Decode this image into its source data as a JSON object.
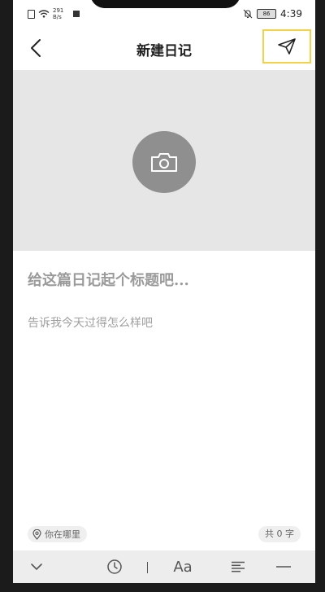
{
  "status_bar": {
    "net_speed_top": "291",
    "net_speed_bottom": "B/s",
    "battery": "86",
    "time": "4:39"
  },
  "header": {
    "title": "新建日记"
  },
  "editor": {
    "title_placeholder": "给这篇日记起个标题吧...",
    "content_placeholder": "告诉我今天过得怎么样吧"
  },
  "footer": {
    "location_label": "你在哪里",
    "word_count": "共 0 字"
  },
  "toolbar": {
    "font_label": "Aa"
  },
  "colors": {
    "highlight": "#f2d24b",
    "cover_bg": "#e6e6e6",
    "camera_circle": "#8f8f8f"
  }
}
